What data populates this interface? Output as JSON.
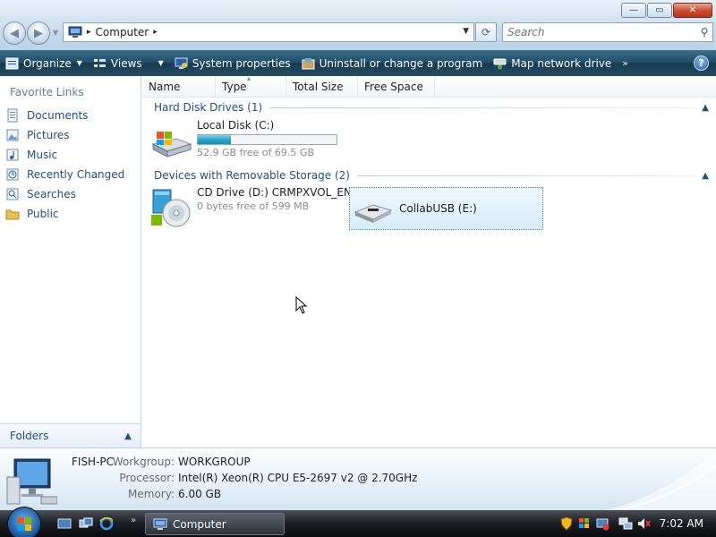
{
  "window": {
    "controls": {
      "minimize": "—",
      "maximize": "▭",
      "close": "✕"
    }
  },
  "address": {
    "crumb": "Computer",
    "separator": "▸"
  },
  "search": {
    "placeholder": "Search"
  },
  "toolbar": {
    "organize": "Organize",
    "views": "Views",
    "system_properties": "System properties",
    "uninstall": "Uninstall or change a program",
    "map_drive": "Map network drive",
    "more": "»",
    "help": "?"
  },
  "left_pane": {
    "title": "Favorite Links",
    "items": [
      {
        "label": "Documents",
        "icon": "documents-icon"
      },
      {
        "label": "Pictures",
        "icon": "pictures-icon"
      },
      {
        "label": "Music",
        "icon": "music-icon"
      },
      {
        "label": "Recently Changed",
        "icon": "recent-icon"
      },
      {
        "label": "Searches",
        "icon": "searches-icon"
      },
      {
        "label": "Public",
        "icon": "public-folder-icon"
      }
    ],
    "folders": "Folders"
  },
  "columns": [
    "Name",
    "Type",
    "Total Size",
    "Free Space"
  ],
  "groups": {
    "hdd": "Hard Disk Drives (1)",
    "removable": "Devices with Removable Storage (2)"
  },
  "drives": {
    "c": {
      "name": "Local Disk (C:)",
      "free": "52.9 GB free of 69.5 GB",
      "used_fraction": 0.24
    },
    "d": {
      "name": "CD Drive (D:) CRMPXVOL_EN",
      "free": "0 bytes free of 599 MB"
    },
    "e": {
      "name": "CollabUSB (E:)"
    }
  },
  "details": {
    "computer_name": "FISH-PC",
    "workgroup_label": "Workgroup:",
    "workgroup": "WORKGROUP",
    "processor_label": "Processor:",
    "processor": "Intel(R) Xeon(R) CPU E5-2697 v2 @ 2.70GHz",
    "memory_label": "Memory:",
    "memory": "6.00 GB"
  },
  "taskbar": {
    "window_button": "Computer",
    "more": "»",
    "clock": "7:02 AM"
  },
  "colors": {
    "toolbar": "#1f4a63",
    "link": "#1e4e8c",
    "bar_fill": "#25a6cd"
  }
}
